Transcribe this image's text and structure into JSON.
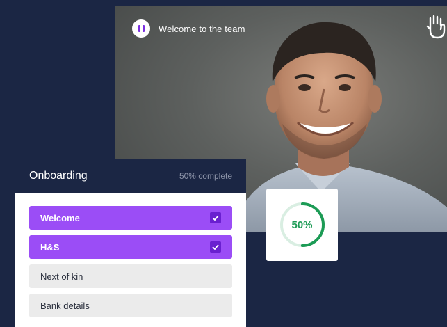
{
  "video": {
    "title": "Welcome to the team",
    "controls": {
      "pause_icon": "pause-icon",
      "hand_icon": "raise-hand-icon"
    }
  },
  "onboarding": {
    "title": "Onboarding",
    "progress_text": "50% complete",
    "items": [
      {
        "label": "Welcome",
        "completed": true
      },
      {
        "label": "H&S",
        "completed": true
      },
      {
        "label": "Next of kin",
        "completed": false
      },
      {
        "label": "Bank details",
        "completed": false
      }
    ]
  },
  "progress_ring": {
    "label": "50%",
    "fraction": 0.5
  },
  "colors": {
    "background": "#1b2644",
    "accent_purple": "#9b4df6",
    "check_purple": "#6a1fd0",
    "ring_green": "#1c9b55",
    "ring_track": "#d9eee2"
  }
}
